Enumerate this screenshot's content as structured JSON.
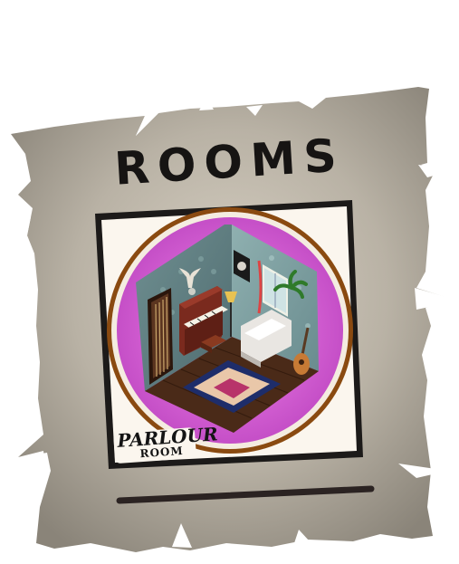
{
  "poster": {
    "title": "ROOMS",
    "card": {
      "name_line1": "PARLOUR",
      "name_line2": "ROOM",
      "theme_color": "#d35fd2",
      "ring_color": "#8a4a10"
    },
    "icons": [
      "parlour-room-illustration",
      "piano-icon",
      "guitar-icon",
      "sofa-icon",
      "bull-skull-icon",
      "rug-icon",
      "lamp-icon",
      "plant-icon",
      "door-icon",
      "window-icon"
    ]
  }
}
